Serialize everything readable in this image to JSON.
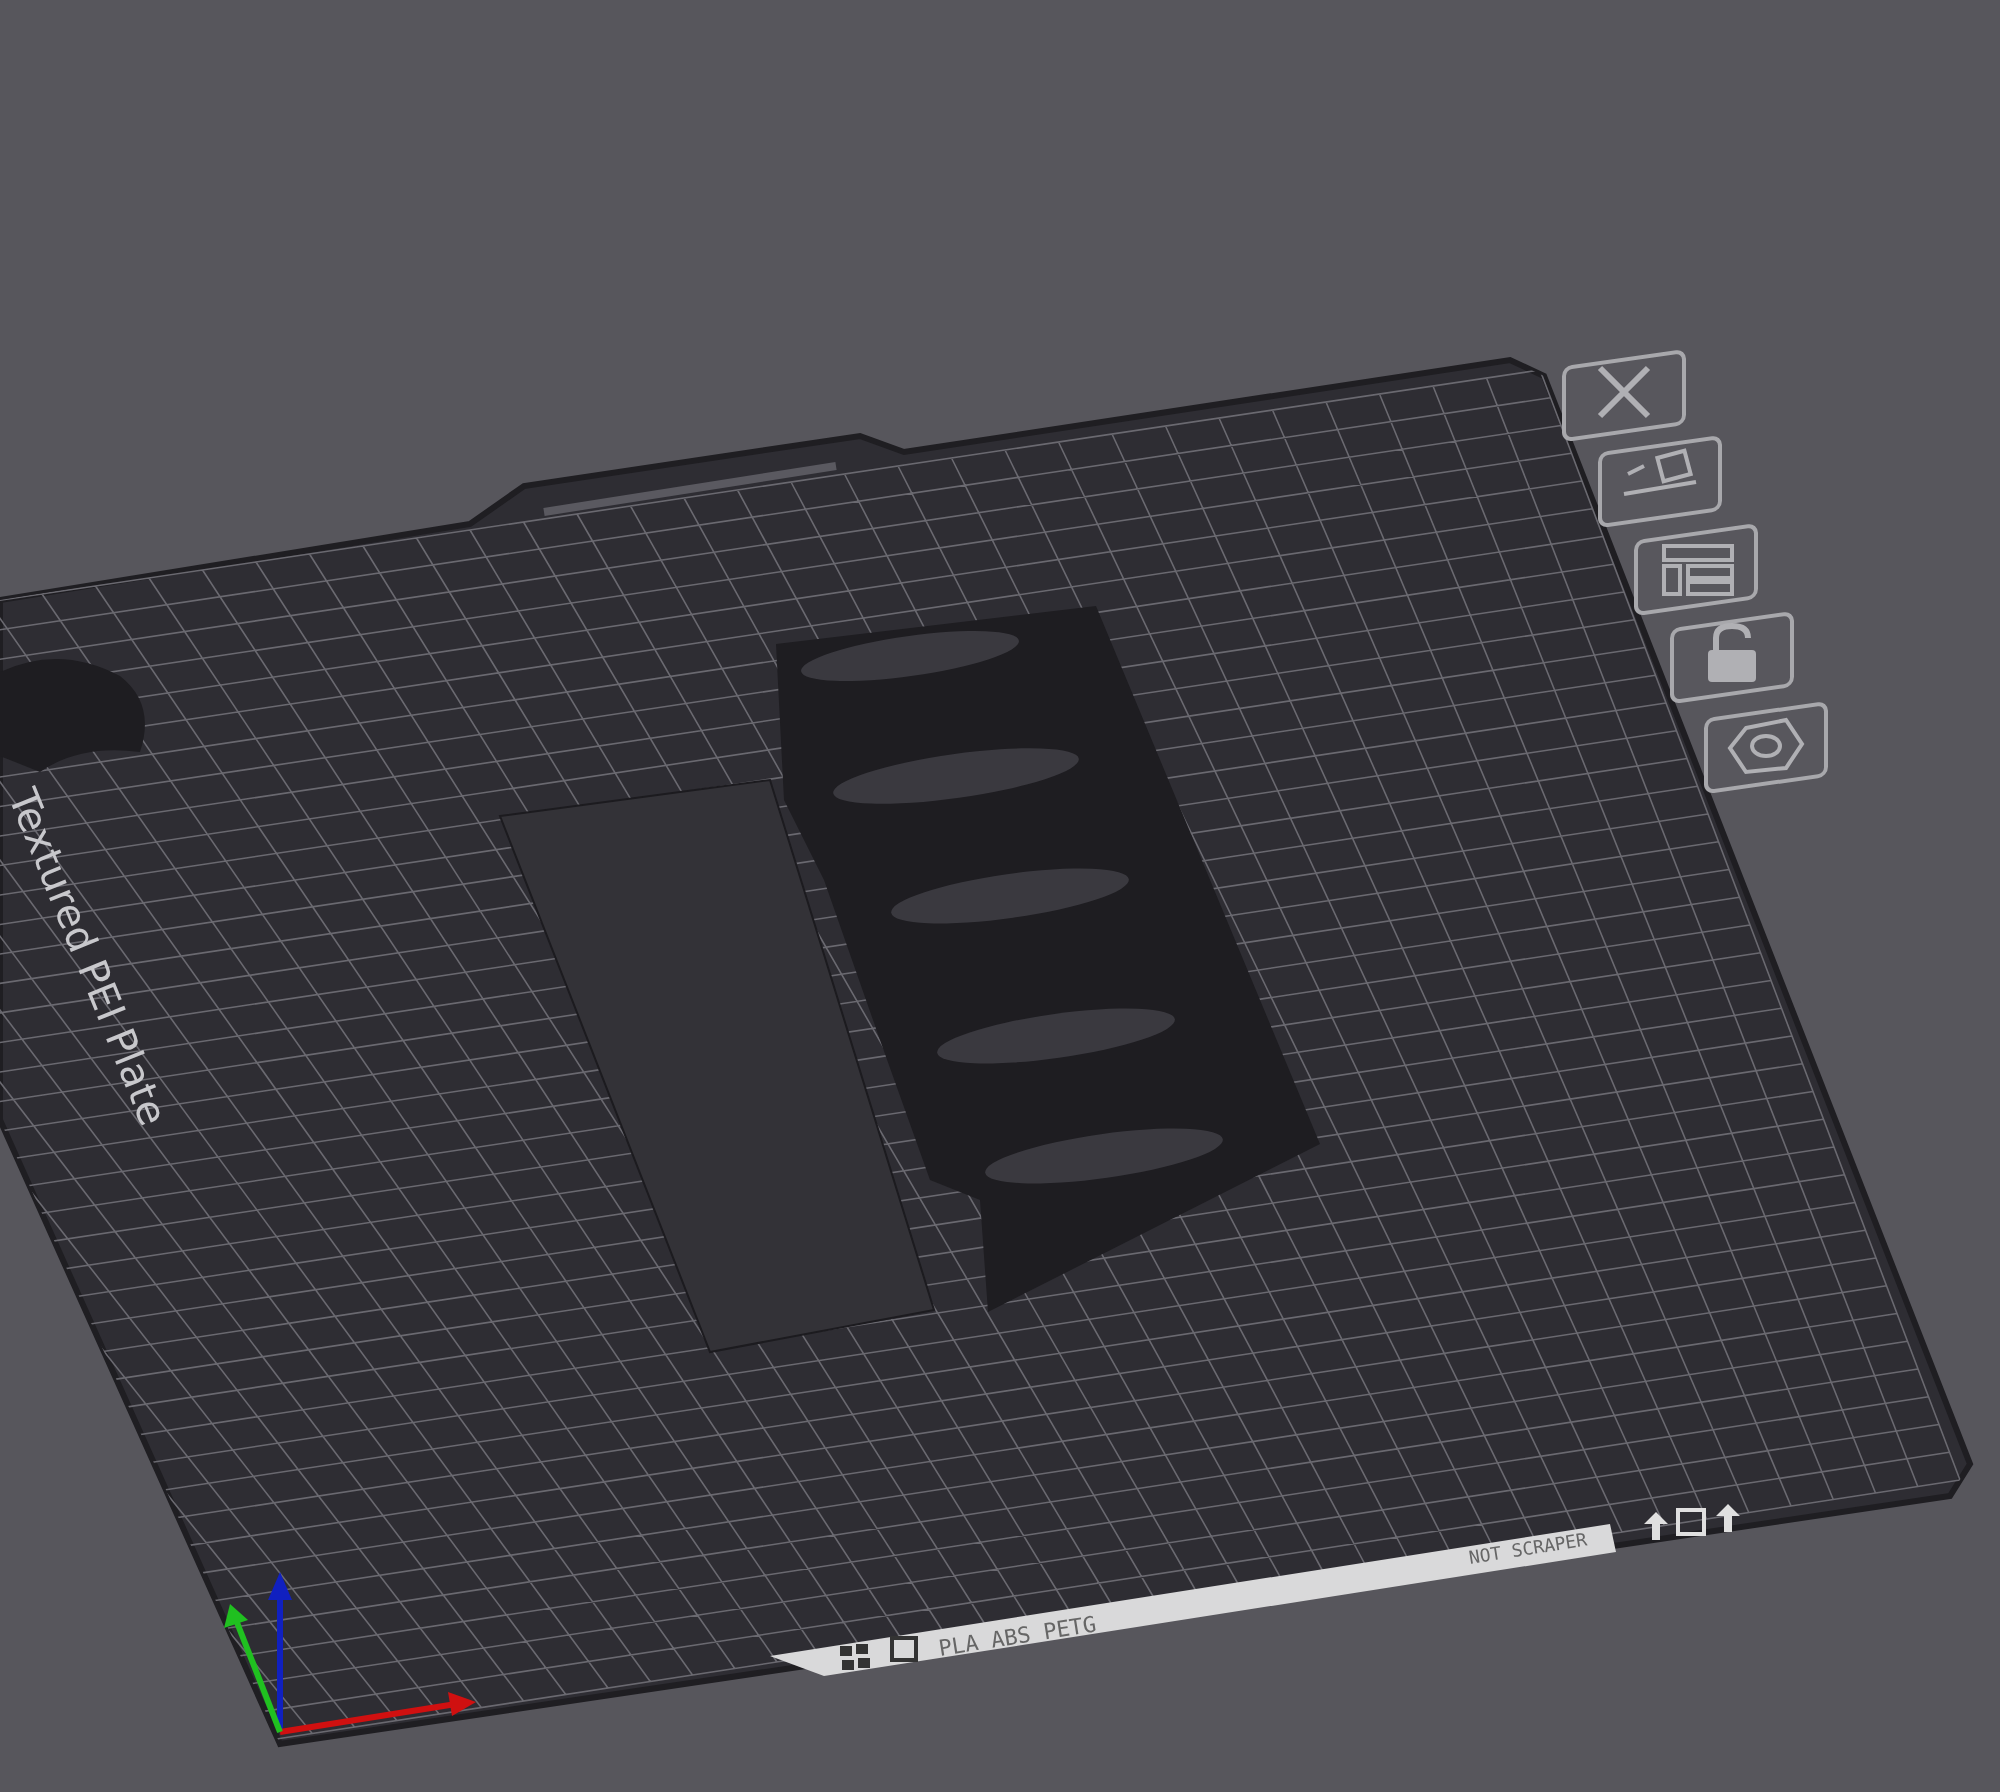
{
  "plate": {
    "name": "Textured PEI Plate",
    "label": "PLA ABS PETG",
    "note": "NOT SCRAPER"
  },
  "toolbar": [
    {
      "kind": "close"
    },
    {
      "kind": "arrange"
    },
    {
      "kind": "layout"
    },
    {
      "kind": "lock"
    },
    {
      "kind": "settings"
    }
  ]
}
